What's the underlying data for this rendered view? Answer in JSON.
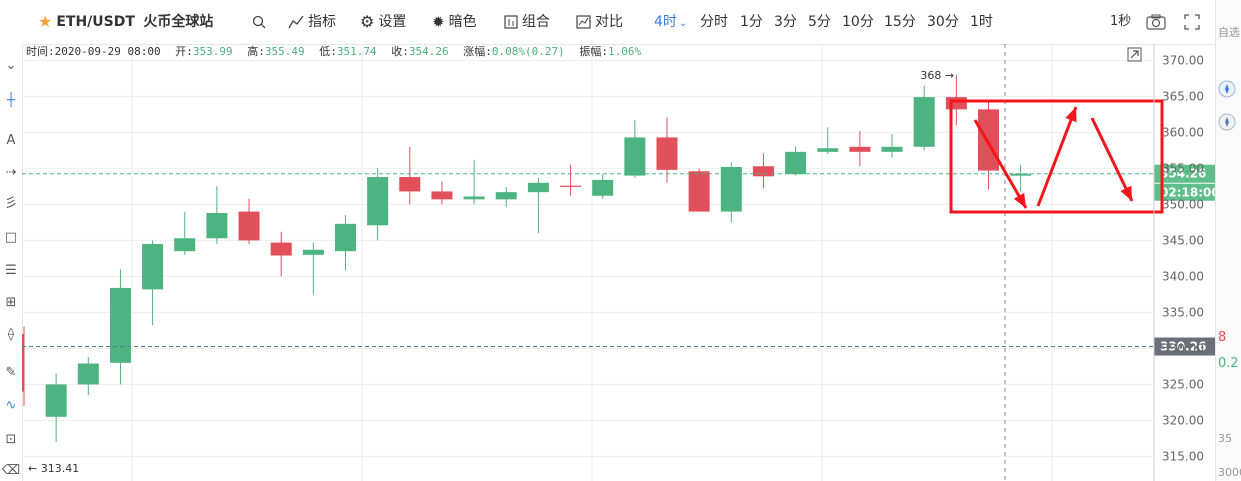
{
  "toolbar": {
    "symbol": "ETH/USDT",
    "exchange": "火币全球站",
    "indicators": "指标",
    "settings": "设置",
    "theme": "暗色",
    "combo": "组合",
    "compare": "对比",
    "interval_active": "4时",
    "intervals": [
      "分时",
      "1分",
      "3分",
      "5分",
      "10分",
      "15分",
      "30分",
      "1时"
    ],
    "refresh": "1秒",
    "icons": [
      "star-icon",
      "search-icon",
      "indicator-icon",
      "gear-icon",
      "sun-icon",
      "combo-icon",
      "compare-icon",
      "chevron-down-icon",
      "camera-icon",
      "fullscreen-icon"
    ]
  },
  "ohlc": {
    "time_label": "时间:",
    "time": "2020-09-29 08:00",
    "open_label": "开:",
    "open": "353.99",
    "high_label": "高:",
    "high": "355.49",
    "low_label": "低:",
    "low": "351.74",
    "close_label": "收:",
    "close": "354.26",
    "change_label": "涨幅:",
    "change": "0.08%(0.27)",
    "amp_label": "振幅:",
    "amp": "1.06%"
  },
  "right_panel": {
    "top_text": "自选",
    "a": "8",
    "b": "0.2",
    "c": "35",
    "d": "3000"
  },
  "colors": {
    "up": "#4db380",
    "down": "#e04f5a",
    "accent": "#3b7ddd",
    "annotation": "#f5151b",
    "grid": "#eeeeee"
  },
  "chart_data": {
    "type": "candlestick",
    "yticks": [
      315,
      320,
      325,
      330,
      335,
      340,
      345,
      350,
      355,
      360,
      365,
      370
    ],
    "ylim": [
      312,
      372
    ],
    "max_label": "368",
    "min_label": "313.41",
    "last_price": "354.26",
    "countdown": "02:18:00",
    "ref_price": "330.26",
    "candles": [
      {
        "o": 332,
        "h": 333,
        "l": 322,
        "c": 324
      },
      {
        "o": 320.5,
        "h": 326.5,
        "l": 317,
        "c": 325
      },
      {
        "o": 325,
        "h": 328.8,
        "l": 323.5,
        "c": 327.9
      },
      {
        "o": 328,
        "h": 341,
        "l": 325,
        "c": 338.4
      },
      {
        "o": 338.2,
        "h": 345,
        "l": 333.2,
        "c": 344.5
      },
      {
        "o": 343.5,
        "h": 349,
        "l": 343,
        "c": 345.3
      },
      {
        "o": 345.3,
        "h": 352.5,
        "l": 344.5,
        "c": 348.8
      },
      {
        "o": 349,
        "h": 350.8,
        "l": 344.5,
        "c": 345
      },
      {
        "o": 344.7,
        "h": 346.2,
        "l": 340,
        "c": 342.9
      },
      {
        "o": 343,
        "h": 344.7,
        "l": 337.5,
        "c": 343.7
      },
      {
        "o": 343.5,
        "h": 348.5,
        "l": 340.8,
        "c": 347.3
      },
      {
        "o": 347.1,
        "h": 355,
        "l": 345,
        "c": 353.8
      },
      {
        "o": 353.8,
        "h": 358,
        "l": 350,
        "c": 351.8
      },
      {
        "o": 351.8,
        "h": 353.2,
        "l": 350,
        "c": 350.7
      },
      {
        "o": 350.7,
        "h": 356.2,
        "l": 350,
        "c": 351.1
      },
      {
        "o": 350.7,
        "h": 352.4,
        "l": 349.6,
        "c": 351.7
      },
      {
        "o": 351.7,
        "h": 353.7,
        "l": 346,
        "c": 353
      },
      {
        "o": 352.6,
        "h": 355.5,
        "l": 351.2,
        "c": 352.5
      },
      {
        "o": 351.2,
        "h": 354.2,
        "l": 350.8,
        "c": 353.4
      },
      {
        "o": 354,
        "h": 361.7,
        "l": 353.7,
        "c": 359.3
      },
      {
        "o": 359.3,
        "h": 362.1,
        "l": 353,
        "c": 354.8
      },
      {
        "o": 354.6,
        "h": 355,
        "l": 349,
        "c": 349
      },
      {
        "o": 349,
        "h": 355.8,
        "l": 347.5,
        "c": 355.2
      },
      {
        "o": 355.3,
        "h": 357.1,
        "l": 352.2,
        "c": 353.9
      },
      {
        "o": 354.2,
        "h": 358,
        "l": 354,
        "c": 357.3
      },
      {
        "o": 357.3,
        "h": 360.7,
        "l": 357,
        "c": 357.8
      },
      {
        "o": 358,
        "h": 360.2,
        "l": 355.3,
        "c": 357.3
      },
      {
        "o": 357.3,
        "h": 359.8,
        "l": 356.5,
        "c": 358
      },
      {
        "o": 358,
        "h": 366.5,
        "l": 357.5,
        "c": 364.9
      },
      {
        "o": 364.9,
        "h": 368,
        "l": 361,
        "c": 363.2
      },
      {
        "o": 363.2,
        "h": 364.4,
        "l": 352.1,
        "c": 354.7
      },
      {
        "o": 353.99,
        "h": 355.49,
        "l": 351.74,
        "c": 354.26
      }
    ]
  }
}
